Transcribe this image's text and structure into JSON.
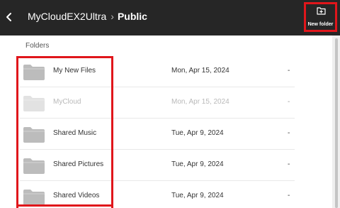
{
  "header": {
    "back_icon": "chevron-left-icon",
    "parent": "MyCloudEX2Ultra",
    "separator": "›",
    "current": "Public",
    "new_folder_label": "New folder",
    "new_folder_icon": "folder-plus-icon"
  },
  "section_label": "Folders",
  "folders": [
    {
      "name": "My New Files",
      "date": "Mon, Apr 15, 2024",
      "size": "-",
      "disabled": false
    },
    {
      "name": "MyCloud",
      "date": "Mon, Apr 15, 2024",
      "size": "-",
      "disabled": true
    },
    {
      "name": "Shared Music",
      "date": "Tue, Apr 9, 2024",
      "size": "-",
      "disabled": false
    },
    {
      "name": "Shared Pictures",
      "date": "Tue, Apr 9, 2024",
      "size": "-",
      "disabled": false
    },
    {
      "name": "Shared Videos",
      "date": "Tue, Apr 9, 2024",
      "size": "-",
      "disabled": false
    }
  ],
  "colors": {
    "topbar": "#262626",
    "highlight": "#e0161b",
    "folder": "#bcbcbc",
    "folder_disabled": "#e2e2e2"
  }
}
